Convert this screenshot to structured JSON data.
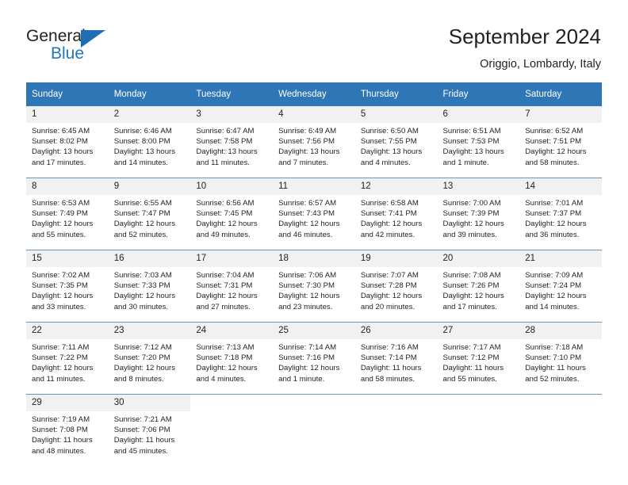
{
  "brand": {
    "name_top": "General",
    "name_bottom": "Blue",
    "accent_color": "#1f78c1",
    "triangle_color": "#1f6eb5"
  },
  "header": {
    "title": "September 2024",
    "subtitle": "Origgio, Lombardy, Italy"
  },
  "theme": {
    "header_row_bg": "#2f76b6",
    "header_row_text": "#ffffff",
    "daynum_bg": "#f1f1f1",
    "grid_line": "#6f93b8",
    "body_text": "#231f20"
  },
  "labels": {
    "sunrise_prefix": "Sunrise:",
    "sunset_prefix": "Sunset:",
    "daylight_prefix": "Daylight:"
  },
  "weekday_headers": [
    "Sunday",
    "Monday",
    "Tuesday",
    "Wednesday",
    "Thursday",
    "Friday",
    "Saturday"
  ],
  "weeks": [
    [
      {
        "day": "1",
        "sunrise": "Sunrise: 6:45 AM",
        "sunset": "Sunset: 8:02 PM",
        "daylight_line1": "Daylight: 13 hours",
        "daylight_line2": "and 17 minutes."
      },
      {
        "day": "2",
        "sunrise": "Sunrise: 6:46 AM",
        "sunset": "Sunset: 8:00 PM",
        "daylight_line1": "Daylight: 13 hours",
        "daylight_line2": "and 14 minutes."
      },
      {
        "day": "3",
        "sunrise": "Sunrise: 6:47 AM",
        "sunset": "Sunset: 7:58 PM",
        "daylight_line1": "Daylight: 13 hours",
        "daylight_line2": "and 11 minutes."
      },
      {
        "day": "4",
        "sunrise": "Sunrise: 6:49 AM",
        "sunset": "Sunset: 7:56 PM",
        "daylight_line1": "Daylight: 13 hours",
        "daylight_line2": "and 7 minutes."
      },
      {
        "day": "5",
        "sunrise": "Sunrise: 6:50 AM",
        "sunset": "Sunset: 7:55 PM",
        "daylight_line1": "Daylight: 13 hours",
        "daylight_line2": "and 4 minutes."
      },
      {
        "day": "6",
        "sunrise": "Sunrise: 6:51 AM",
        "sunset": "Sunset: 7:53 PM",
        "daylight_line1": "Daylight: 13 hours",
        "daylight_line2": "and 1 minute."
      },
      {
        "day": "7",
        "sunrise": "Sunrise: 6:52 AM",
        "sunset": "Sunset: 7:51 PM",
        "daylight_line1": "Daylight: 12 hours",
        "daylight_line2": "and 58 minutes."
      }
    ],
    [
      {
        "day": "8",
        "sunrise": "Sunrise: 6:53 AM",
        "sunset": "Sunset: 7:49 PM",
        "daylight_line1": "Daylight: 12 hours",
        "daylight_line2": "and 55 minutes."
      },
      {
        "day": "9",
        "sunrise": "Sunrise: 6:55 AM",
        "sunset": "Sunset: 7:47 PM",
        "daylight_line1": "Daylight: 12 hours",
        "daylight_line2": "and 52 minutes."
      },
      {
        "day": "10",
        "sunrise": "Sunrise: 6:56 AM",
        "sunset": "Sunset: 7:45 PM",
        "daylight_line1": "Daylight: 12 hours",
        "daylight_line2": "and 49 minutes."
      },
      {
        "day": "11",
        "sunrise": "Sunrise: 6:57 AM",
        "sunset": "Sunset: 7:43 PM",
        "daylight_line1": "Daylight: 12 hours",
        "daylight_line2": "and 46 minutes."
      },
      {
        "day": "12",
        "sunrise": "Sunrise: 6:58 AM",
        "sunset": "Sunset: 7:41 PM",
        "daylight_line1": "Daylight: 12 hours",
        "daylight_line2": "and 42 minutes."
      },
      {
        "day": "13",
        "sunrise": "Sunrise: 7:00 AM",
        "sunset": "Sunset: 7:39 PM",
        "daylight_line1": "Daylight: 12 hours",
        "daylight_line2": "and 39 minutes."
      },
      {
        "day": "14",
        "sunrise": "Sunrise: 7:01 AM",
        "sunset": "Sunset: 7:37 PM",
        "daylight_line1": "Daylight: 12 hours",
        "daylight_line2": "and 36 minutes."
      }
    ],
    [
      {
        "day": "15",
        "sunrise": "Sunrise: 7:02 AM",
        "sunset": "Sunset: 7:35 PM",
        "daylight_line1": "Daylight: 12 hours",
        "daylight_line2": "and 33 minutes."
      },
      {
        "day": "16",
        "sunrise": "Sunrise: 7:03 AM",
        "sunset": "Sunset: 7:33 PM",
        "daylight_line1": "Daylight: 12 hours",
        "daylight_line2": "and 30 minutes."
      },
      {
        "day": "17",
        "sunrise": "Sunrise: 7:04 AM",
        "sunset": "Sunset: 7:31 PM",
        "daylight_line1": "Daylight: 12 hours",
        "daylight_line2": "and 27 minutes."
      },
      {
        "day": "18",
        "sunrise": "Sunrise: 7:06 AM",
        "sunset": "Sunset: 7:30 PM",
        "daylight_line1": "Daylight: 12 hours",
        "daylight_line2": "and 23 minutes."
      },
      {
        "day": "19",
        "sunrise": "Sunrise: 7:07 AM",
        "sunset": "Sunset: 7:28 PM",
        "daylight_line1": "Daylight: 12 hours",
        "daylight_line2": "and 20 minutes."
      },
      {
        "day": "20",
        "sunrise": "Sunrise: 7:08 AM",
        "sunset": "Sunset: 7:26 PM",
        "daylight_line1": "Daylight: 12 hours",
        "daylight_line2": "and 17 minutes."
      },
      {
        "day": "21",
        "sunrise": "Sunrise: 7:09 AM",
        "sunset": "Sunset: 7:24 PM",
        "daylight_line1": "Daylight: 12 hours",
        "daylight_line2": "and 14 minutes."
      }
    ],
    [
      {
        "day": "22",
        "sunrise": "Sunrise: 7:11 AM",
        "sunset": "Sunset: 7:22 PM",
        "daylight_line1": "Daylight: 12 hours",
        "daylight_line2": "and 11 minutes."
      },
      {
        "day": "23",
        "sunrise": "Sunrise: 7:12 AM",
        "sunset": "Sunset: 7:20 PM",
        "daylight_line1": "Daylight: 12 hours",
        "daylight_line2": "and 8 minutes."
      },
      {
        "day": "24",
        "sunrise": "Sunrise: 7:13 AM",
        "sunset": "Sunset: 7:18 PM",
        "daylight_line1": "Daylight: 12 hours",
        "daylight_line2": "and 4 minutes."
      },
      {
        "day": "25",
        "sunrise": "Sunrise: 7:14 AM",
        "sunset": "Sunset: 7:16 PM",
        "daylight_line1": "Daylight: 12 hours",
        "daylight_line2": "and 1 minute."
      },
      {
        "day": "26",
        "sunrise": "Sunrise: 7:16 AM",
        "sunset": "Sunset: 7:14 PM",
        "daylight_line1": "Daylight: 11 hours",
        "daylight_line2": "and 58 minutes."
      },
      {
        "day": "27",
        "sunrise": "Sunrise: 7:17 AM",
        "sunset": "Sunset: 7:12 PM",
        "daylight_line1": "Daylight: 11 hours",
        "daylight_line2": "and 55 minutes."
      },
      {
        "day": "28",
        "sunrise": "Sunrise: 7:18 AM",
        "sunset": "Sunset: 7:10 PM",
        "daylight_line1": "Daylight: 11 hours",
        "daylight_line2": "and 52 minutes."
      }
    ],
    [
      {
        "day": "29",
        "sunrise": "Sunrise: 7:19 AM",
        "sunset": "Sunset: 7:08 PM",
        "daylight_line1": "Daylight: 11 hours",
        "daylight_line2": "and 48 minutes."
      },
      {
        "day": "30",
        "sunrise": "Sunrise: 7:21 AM",
        "sunset": "Sunset: 7:06 PM",
        "daylight_line1": "Daylight: 11 hours",
        "daylight_line2": "and 45 minutes."
      },
      {
        "day": "",
        "sunrise": "",
        "sunset": "",
        "daylight_line1": "",
        "daylight_line2": ""
      },
      {
        "day": "",
        "sunrise": "",
        "sunset": "",
        "daylight_line1": "",
        "daylight_line2": ""
      },
      {
        "day": "",
        "sunrise": "",
        "sunset": "",
        "daylight_line1": "",
        "daylight_line2": ""
      },
      {
        "day": "",
        "sunrise": "",
        "sunset": "",
        "daylight_line1": "",
        "daylight_line2": ""
      },
      {
        "day": "",
        "sunrise": "",
        "sunset": "",
        "daylight_line1": "",
        "daylight_line2": ""
      }
    ]
  ]
}
